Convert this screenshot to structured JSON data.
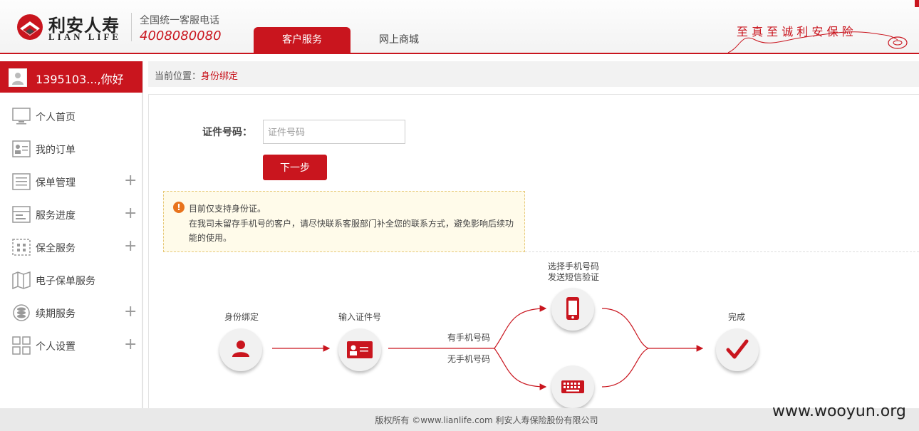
{
  "brand": {
    "logo_cn": "利安人寿",
    "logo_en": "LIAN LIFE",
    "hotline_label": "全国统一客服电话",
    "hotline_number": "4008080080",
    "slogan": "至 真 至 诚 利 安 保 险",
    "brand_color": "#c9151e"
  },
  "nav": {
    "tabs": [
      {
        "label": "客户服务",
        "active": true
      },
      {
        "label": "网上商城",
        "active": false
      }
    ]
  },
  "user": {
    "greeting": "1395103...,你好"
  },
  "sidebar": {
    "items": [
      {
        "label": "个人首页",
        "icon": "monitor-icon",
        "expandable": false
      },
      {
        "label": "我的订单",
        "icon": "id-card-icon",
        "expandable": false
      },
      {
        "label": "保单管理",
        "icon": "list-icon",
        "expandable": true
      },
      {
        "label": "服务进度",
        "icon": "progress-icon",
        "expandable": true
      },
      {
        "label": "保全服务",
        "icon": "grid-box-icon",
        "expandable": true
      },
      {
        "label": "电子保单服务",
        "icon": "map-icon",
        "expandable": false
      },
      {
        "label": "续期服务",
        "icon": "coins-icon",
        "expandable": true
      },
      {
        "label": "个人设置",
        "icon": "apps-icon",
        "expandable": true
      }
    ],
    "expand_symbol": "+"
  },
  "breadcrumb": {
    "prefix": "当前位置：",
    "current": "身份绑定"
  },
  "form": {
    "id_label": "证件号码：",
    "id_placeholder": "证件号码",
    "id_value": "",
    "next_button": "下一步"
  },
  "notice": {
    "icon": "!",
    "line1": "目前仅支持身份证。",
    "line2": "在我司未留存手机号的客户，请尽快联系客服部门补全您的联系方式，避免影响后续功能的使用。"
  },
  "flow": {
    "step_bind": "身份绑定",
    "step_input_id": "输入证件号",
    "branch_has_phone": "有手机号码",
    "branch_no_phone": "无手机号码",
    "step_sms_line1": "选择手机号码",
    "step_sms_line2": "发送短信验证",
    "step_done": "完成"
  },
  "footer": {
    "copyright": "版权所有 ©www.lianlife.com 利安人寿保险股份有限公司"
  },
  "watermark": "www.wooyun.org"
}
